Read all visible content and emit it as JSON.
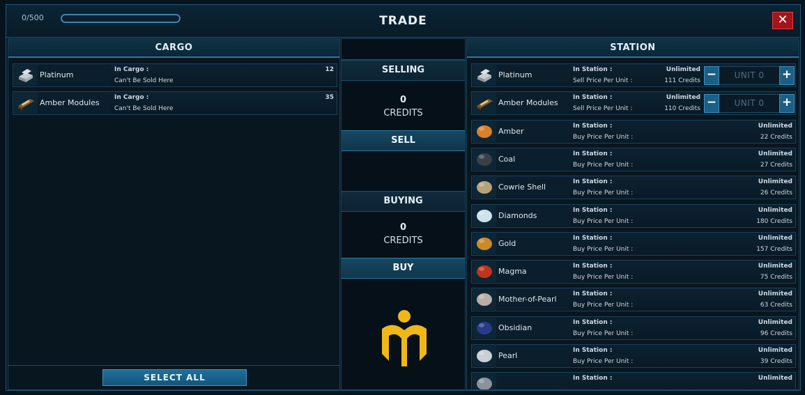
{
  "header": {
    "capacity_label": "0/500",
    "capacity_fraction": 0.0,
    "title": "TRADE",
    "close_label": "✕"
  },
  "cargo": {
    "title": "CARGO",
    "items": [
      {
        "name": "Platinum",
        "label": "In Cargo :",
        "qty": "12",
        "note": "Can't Be Sold Here",
        "icon": "platinum-icon"
      },
      {
        "name": "Amber Modules",
        "label": "In Cargo :",
        "qty": "35",
        "note": "Can't Be Sold Here",
        "icon": "amber-modules-icon"
      }
    ],
    "select_all_label": "SELECT ALL"
  },
  "middle": {
    "selling_label": "SELLING",
    "selling_value": "0",
    "selling_unit": "CREDITS",
    "sell_button": "SELL",
    "buying_label": "BUYING",
    "buying_value": "0",
    "buying_unit": "CREDITS",
    "buy_button": "BUY",
    "logo_color": "#f0b816"
  },
  "station": {
    "title": "STATION",
    "sellable": [
      {
        "name": "Platinum",
        "stock_label": "In Station :",
        "stock": "Unlimited",
        "price_label": "Sell Price Per Unit :",
        "price": "111 Credits",
        "unit": "UNIT 0",
        "icon": "platinum-icon"
      },
      {
        "name": "Amber Modules",
        "stock_label": "In Station :",
        "stock": "Unlimited",
        "price_label": "Sell Price Per Unit :",
        "price": "110 Credits",
        "unit": "UNIT 0",
        "icon": "amber-modules-icon"
      }
    ],
    "buyable": [
      {
        "name": "Amber",
        "stock_label": "In Station :",
        "stock": "Unlimited",
        "price_label": "Buy Price Per Unit :",
        "price": "22 Credits",
        "color": "#d9802a"
      },
      {
        "name": "Coal",
        "stock_label": "In Station :",
        "stock": "Unlimited",
        "price_label": "Buy Price Per Unit :",
        "price": "27 Credits",
        "color": "#3a4048"
      },
      {
        "name": "Cowrie Shell",
        "stock_label": "In Station :",
        "stock": "Unlimited",
        "price_label": "Buy Price Per Unit :",
        "price": "26 Credits",
        "color": "#b8a27a"
      },
      {
        "name": "Diamonds",
        "stock_label": "In Station :",
        "stock": "Unlimited",
        "price_label": "Buy Price Per Unit :",
        "price": "180 Credits",
        "color": "#cfe2ea"
      },
      {
        "name": "Gold",
        "stock_label": "In Station :",
        "stock": "Unlimited",
        "price_label": "Buy Price Per Unit :",
        "price": "157 Credits",
        "color": "#c98b2a"
      },
      {
        "name": "Magma",
        "stock_label": "In Station :",
        "stock": "Unlimited",
        "price_label": "Buy Price Per Unit :",
        "price": "75 Credits",
        "color": "#c2331c"
      },
      {
        "name": "Mother-of-Pearl",
        "stock_label": "In Station :",
        "stock": "Unlimited",
        "price_label": "Buy Price Per Unit :",
        "price": "63 Credits",
        "color": "#b9aea8"
      },
      {
        "name": "Obsidian",
        "stock_label": "In Station :",
        "stock": "Unlimited",
        "price_label": "Buy Price Per Unit :",
        "price": "96 Credits",
        "color": "#2a3a8a"
      },
      {
        "name": "Pearl",
        "stock_label": "In Station :",
        "stock": "Unlimited",
        "price_label": "Buy Price Per Unit :",
        "price": "39 Credits",
        "color": "#c9cfd4"
      },
      {
        "name": "",
        "stock_label": "In Station :",
        "stock": "Unlimited",
        "price_label": "",
        "price": "",
        "color": "#8a929a"
      }
    ]
  }
}
